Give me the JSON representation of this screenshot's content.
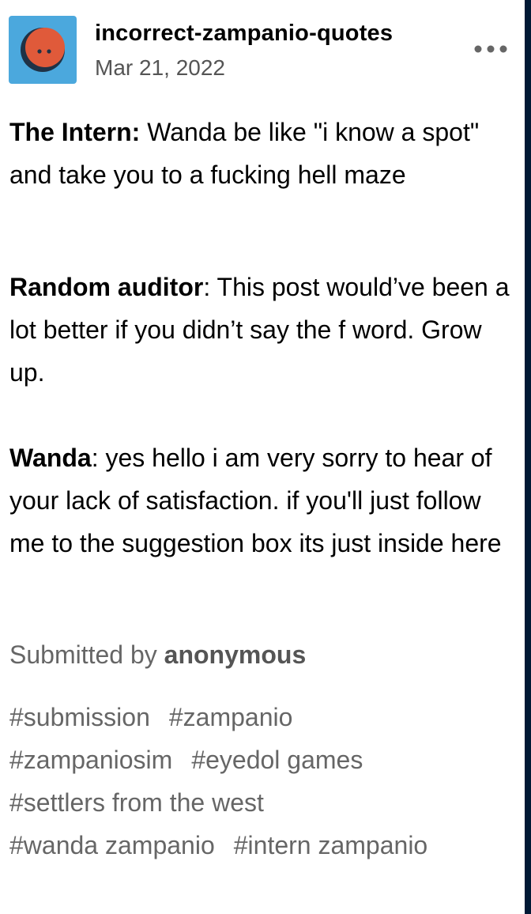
{
  "post": {
    "blog_name": "incorrect-zampanio-quotes",
    "date": "Mar 21, 2022",
    "more_icon": "more-horizontal-icon",
    "avatar_icon": "avatar-orange-face",
    "colors": {
      "avatar_bg": "#4ba8dd",
      "avatar_face": "#e05a3a",
      "right_edge": "#001935",
      "secondary_text": "#666666"
    }
  },
  "dialogue": [
    {
      "speaker": "The Intern:",
      "text": " Wanda be like \"i know a spot\" and take you to a fucking hell maze"
    },
    {
      "speaker": "Random auditor",
      "text": ": This post would’ve been a lot better if you didn’t say the f word. Grow up."
    },
    {
      "speaker": "Wanda",
      "text": ": yes hello i am very sorry to hear of your lack of satisfaction. if you'll just follow me to the suggestion box its just inside here"
    }
  ],
  "submission": {
    "prefix": "Submitted by ",
    "name": "anonymous"
  },
  "tags": [
    [
      "#submission",
      "#zampanio"
    ],
    [
      "#zampaniosim",
      "#eyedol games"
    ],
    [
      "#settlers from the west"
    ],
    [
      "#wanda zampanio",
      "#intern zampanio"
    ]
  ]
}
